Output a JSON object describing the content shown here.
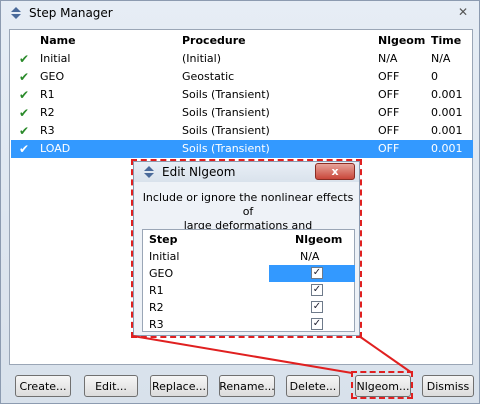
{
  "window": {
    "title": "Step Manager",
    "close_glyph": "✕"
  },
  "table": {
    "headers": {
      "name": "Name",
      "procedure": "Procedure",
      "nlgeom": "Nlgeom",
      "time": "Time"
    },
    "rows": [
      {
        "name": "Initial",
        "procedure": "(Initial)",
        "nlgeom": "N/A",
        "time": "N/A"
      },
      {
        "name": "GEO",
        "procedure": "Geostatic",
        "nlgeom": "OFF",
        "time": "0"
      },
      {
        "name": "R1",
        "procedure": "Soils (Transient)",
        "nlgeom": "OFF",
        "time": "0.001"
      },
      {
        "name": "R2",
        "procedure": "Soils (Transient)",
        "nlgeom": "OFF",
        "time": "0.001"
      },
      {
        "name": "R3",
        "procedure": "Soils (Transient)",
        "nlgeom": "OFF",
        "time": "0.001"
      },
      {
        "name": "LOAD",
        "procedure": "Soils (Transient)",
        "nlgeom": "OFF",
        "time": "0.001"
      }
    ],
    "selected_row": "LOAD"
  },
  "buttons": {
    "create": "Create...",
    "edit": "Edit...",
    "replace": "Replace...",
    "rename": "Rename...",
    "delete": "Delete...",
    "nlgeom": "Nlgeom...",
    "dismiss": "Dismiss"
  },
  "dialog": {
    "title": "Edit Nlgeom",
    "close_glyph": "x",
    "description_line1": "Include or ignore the nonlinear effects of",
    "description_line2": "large deformations and displacements.",
    "headers": {
      "step": "Step",
      "nlgeom": "Nlgeom"
    },
    "rows": [
      {
        "step": "Initial",
        "value": "N/A",
        "checked": null
      },
      {
        "step": "GEO",
        "value": "",
        "checked": true
      },
      {
        "step": "R1",
        "value": "",
        "checked": true
      },
      {
        "step": "R2",
        "value": "",
        "checked": true
      },
      {
        "step": "R3",
        "value": "",
        "checked": true
      }
    ],
    "check_glyph": "✓"
  },
  "check_glyph": "✔",
  "colors": {
    "selection": "#3399ff",
    "check_green": "#2a8a2a",
    "annotation_red": "#e02020"
  }
}
